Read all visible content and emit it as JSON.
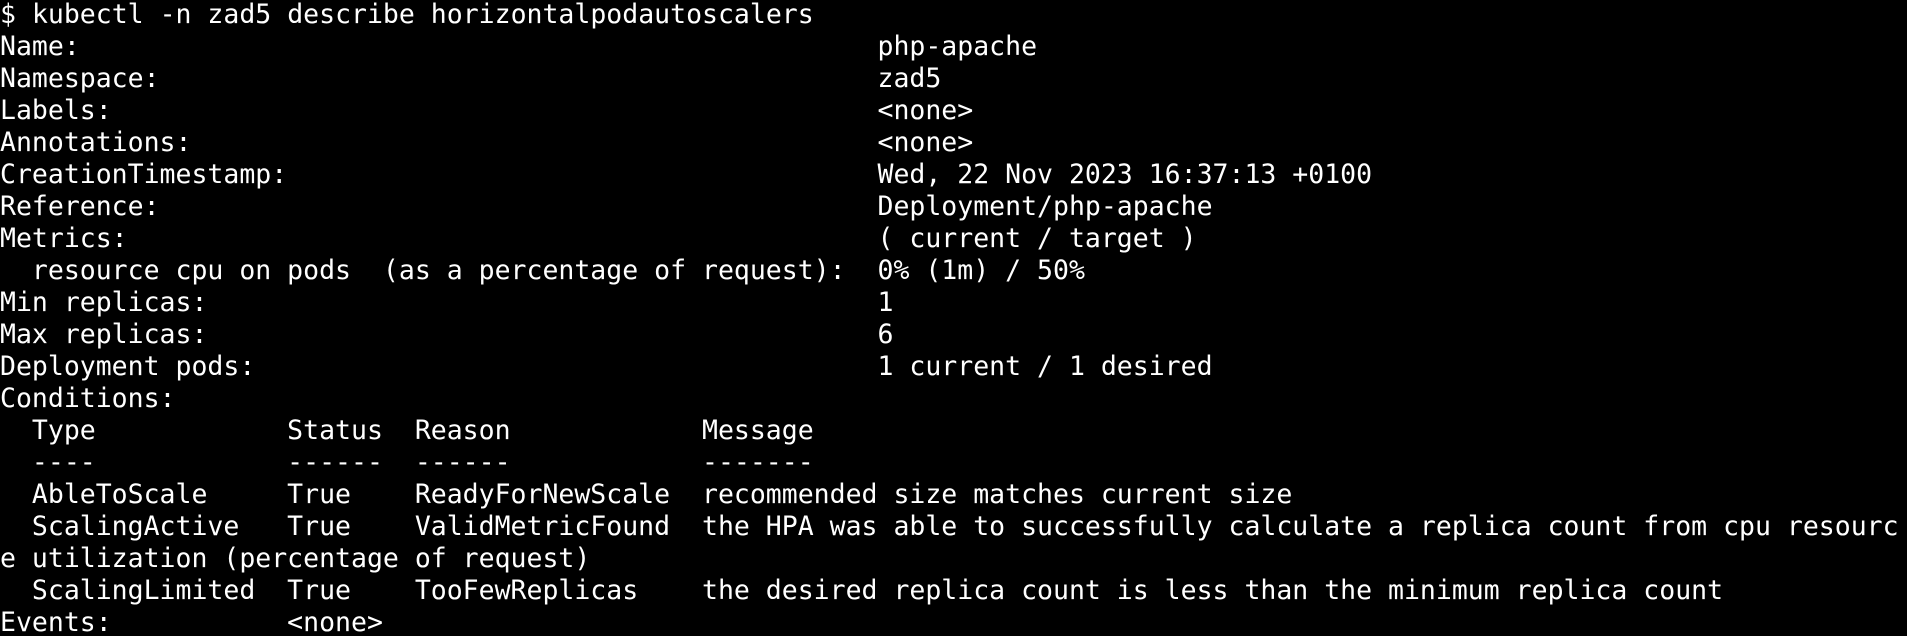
{
  "terminal": {
    "background": "#000000",
    "foreground": "#ffffff",
    "prompt": "$",
    "command": "kubectl -n zad5 describe horizontalpodautoscalers",
    "lines": [
      "Name:                                                  php-apache",
      "Namespace:                                             zad5",
      "Labels:                                                <none>",
      "Annotations:                                           <none>",
      "CreationTimestamp:                                     Wed, 22 Nov 2023 16:37:13 +0100",
      "Reference:                                             Deployment/php-apache",
      "Metrics:                                               ( current / target )",
      "  resource cpu on pods  (as a percentage of request):  0% (1m) / 50%",
      "Min replicas:                                          1",
      "Max replicas:                                          6",
      "Deployment pods:                                       1 current / 1 desired",
      "Conditions:",
      "  Type            Status  Reason            Message",
      "  ----            ------  ------            -------",
      "  AbleToScale     True    ReadyForNewScale  recommended size matches current size",
      "  ScalingActive   True    ValidMetricFound  the HPA was able to successfully calculate a replica count from cpu resourc",
      "e utilization (percentage of request)",
      "  ScalingLimited  True    TooFewReplicas    the desired replica count is less than the minimum replica count",
      "Events:           <none>"
    ]
  }
}
